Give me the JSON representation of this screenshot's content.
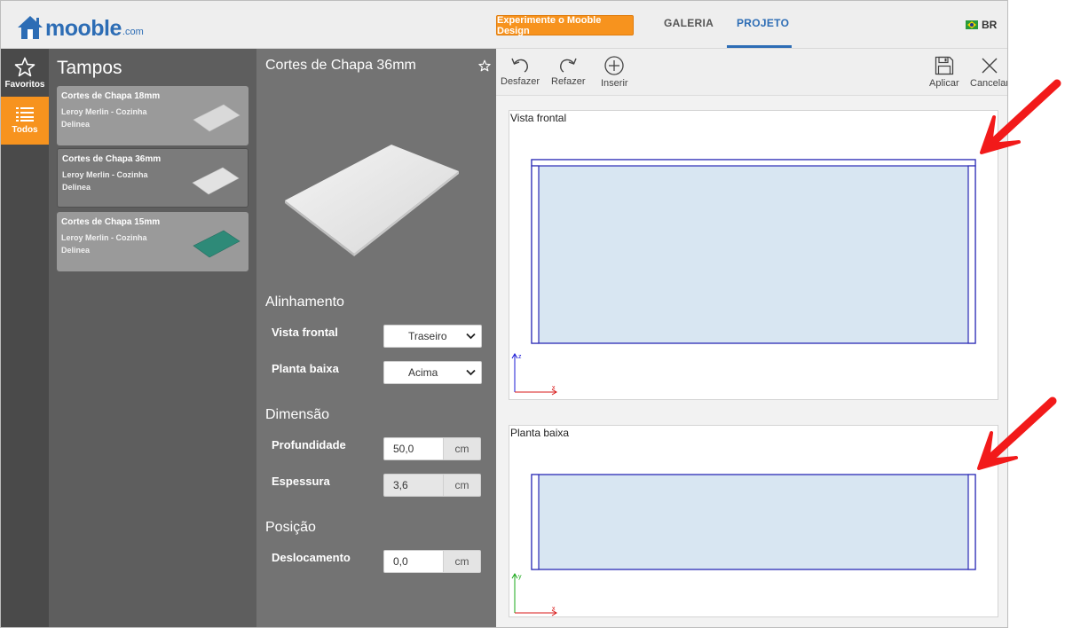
{
  "header": {
    "logo_text": "mooble",
    "logo_suffix": ".com",
    "promo_button": "Experimente o Mooble Design",
    "nav": {
      "galeria": "GALERIA",
      "projeto": "PROJETO"
    },
    "language": "BR",
    "accent_color": "#2d6db5",
    "promo_color": "#f7931e"
  },
  "rail": {
    "favoritos": "Favoritos",
    "todos": "Todos"
  },
  "catalog": {
    "title": "Tampos",
    "items": [
      {
        "title": "Cortes de Chapa 18mm",
        "brand": "Leroy Merlin - Cozinha",
        "line": "Delinea",
        "thumb_color": "#dcdcdc"
      },
      {
        "title": "Cortes de Chapa 36mm",
        "brand": "Leroy Merlin - Cozinha",
        "line": "Delinea",
        "thumb_color": "#e2e2e2"
      },
      {
        "title": "Cortes de Chapa 15mm",
        "brand": "Leroy Merlin - Cozinha",
        "line": "Delinea",
        "thumb_color": "#2e8a78"
      }
    ]
  },
  "detail": {
    "title": "Cortes de Chapa 36mm",
    "alinhamento": {
      "title": "Alinhamento",
      "vista_frontal_label": "Vista frontal",
      "vista_frontal_value": "Traseiro",
      "planta_baixa_label": "Planta baixa",
      "planta_baixa_value": "Acima"
    },
    "dimensao": {
      "title": "Dimensão",
      "profundidade_label": "Profundidade",
      "profundidade_value": "50,0",
      "espessura_label": "Espessura",
      "espessura_value": "3,6",
      "unit": "cm"
    },
    "posicao": {
      "title": "Posição",
      "deslocamento_label": "Deslocamento",
      "deslocamento_value": "0,0",
      "unit": "cm"
    }
  },
  "toolbar": {
    "undo": "Desfazer",
    "redo": "Refazer",
    "insert": "Inserir",
    "apply": "Aplicar",
    "cancel": "Cancelar"
  },
  "views": {
    "front": {
      "label": "Vista frontal",
      "axis_vertical": "z",
      "axis_horizontal": "x"
    },
    "plan": {
      "label": "Planta baixa",
      "axis_vertical": "y",
      "axis_horizontal": "x"
    }
  }
}
